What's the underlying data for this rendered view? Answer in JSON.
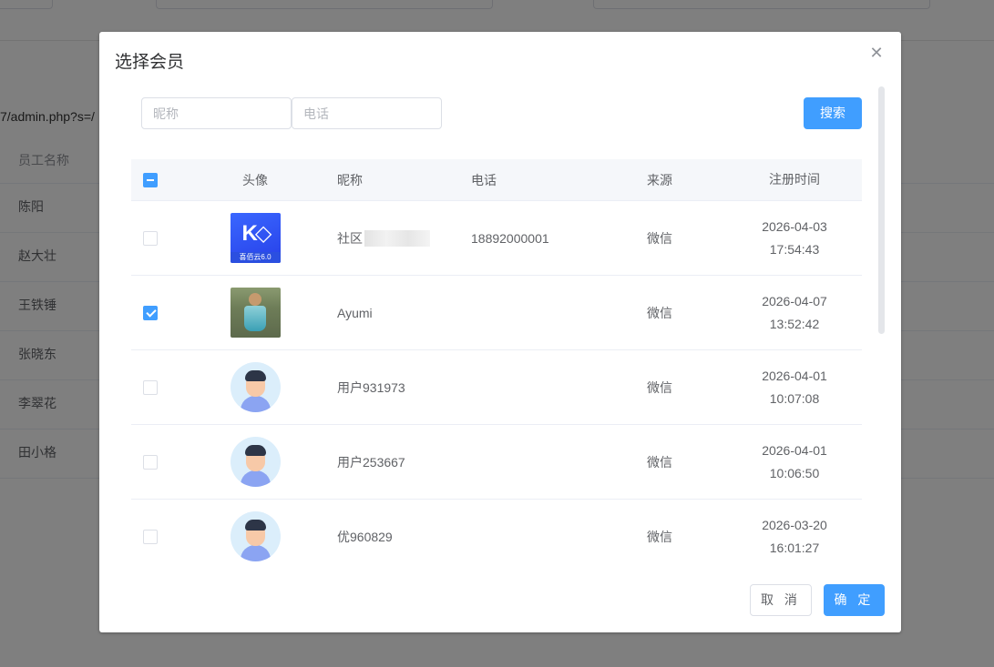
{
  "background": {
    "url_fragment": "7/admin.php?s=/",
    "table_header": "员工名称",
    "employees": [
      "陈阳",
      "赵大壮",
      "王铁锤",
      "张晓东",
      "李翠花",
      "田小格"
    ]
  },
  "dialog": {
    "title": "选择会员",
    "close_icon": "close-icon",
    "search": {
      "nickname_placeholder": "昵称",
      "phone_placeholder": "电话",
      "button_label": "搜索"
    },
    "table": {
      "headers": {
        "avatar": "头像",
        "nickname": "昵称",
        "phone": "电话",
        "source": "来源",
        "registered": "注册时间"
      },
      "select_all_state": "indeterminate",
      "rows": [
        {
          "avatar": "logo-avatar",
          "avatar_tag": "喜佰云6.0",
          "nickname": "社区",
          "nickname_blurred": true,
          "phone": "18892000001",
          "source": "微信",
          "date": "2026-04-03",
          "time": "17:54:43",
          "checked": false
        },
        {
          "avatar": "photo-avatar",
          "nickname": "Ayumi",
          "phone": "",
          "source": "微信",
          "date": "2026-04-07",
          "time": "13:52:42",
          "checked": true
        },
        {
          "avatar": "default-avatar",
          "nickname": "用户931973",
          "phone": "",
          "source": "微信",
          "date": "2026-04-01",
          "time": "10:07:08",
          "checked": false
        },
        {
          "avatar": "default-avatar",
          "nickname": "用户253667",
          "phone": "",
          "source": "微信",
          "date": "2026-04-01",
          "time": "10:06:50",
          "checked": false
        },
        {
          "avatar": "default-avatar",
          "nickname": "优960829",
          "phone": "",
          "source": "微信",
          "date": "2026-03-20",
          "time": "16:01:27",
          "checked": false
        }
      ]
    },
    "footer": {
      "cancel_label": "取 消",
      "confirm_label": "确 定"
    },
    "colors": {
      "primary": "#409eff",
      "overlay": "rgba(0,0,0,0.5)"
    }
  }
}
